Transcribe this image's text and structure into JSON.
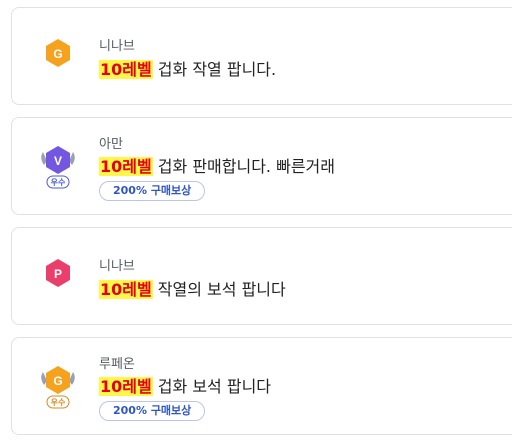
{
  "listings": [
    {
      "server": "니나브",
      "highlight": "10레벨",
      "title_rest": " 겁화 작열 팝니다.",
      "icon": "g-gold-hex-icon",
      "icon_letter": "G",
      "icon_color": "#f5a21e",
      "tag": null
    },
    {
      "server": "아만",
      "highlight": "10레벨",
      "title_rest": " 겁화 판매합니다. 빠른거래",
      "icon": "v-purple-hex-winged-icon",
      "icon_letter": "V",
      "icon_color": "#7457e0",
      "rank_label": "우수",
      "tag": "200% 구매보상"
    },
    {
      "server": "니나브",
      "highlight": "10레벨",
      "title_rest": " 작열의 보석 팝니다",
      "icon": "p-pink-hex-icon",
      "icon_letter": "P",
      "icon_color": "#ea3f6a",
      "tag": null
    },
    {
      "server": "루페온",
      "highlight": "10레벨",
      "title_rest": " 겁화 보석 팝니다",
      "icon": "g-gold-hex-winged-icon",
      "icon_letter": "G",
      "icon_color": "#f5a21e",
      "rank_label": "우수",
      "tag": "200% 구매보상"
    }
  ]
}
